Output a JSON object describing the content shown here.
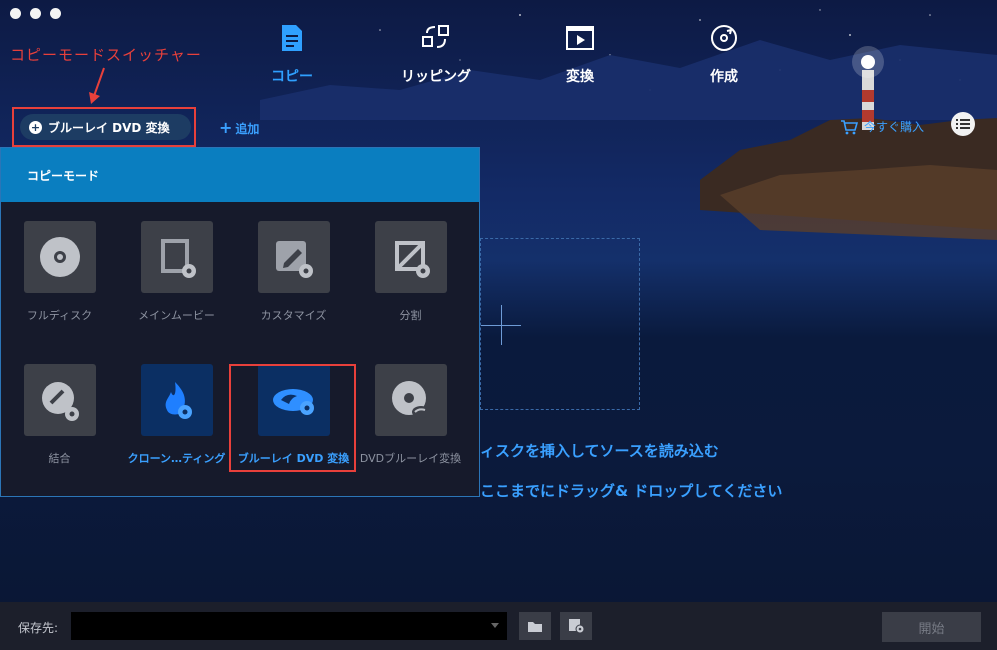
{
  "annotation": {
    "label": "コピーモードスイッチャー",
    "color": "#e8403b"
  },
  "nav": {
    "items": [
      {
        "label": "コピー",
        "icon": "copy-document-icon",
        "active": true
      },
      {
        "label": "リッピング",
        "icon": "ripping-arrows-icon",
        "active": false
      },
      {
        "label": "変換",
        "icon": "video-play-icon",
        "active": false
      },
      {
        "label": "作成",
        "icon": "disc-burn-icon",
        "active": false
      }
    ]
  },
  "toolbar": {
    "mode_button_label": "ブルーレイ DVD 変換",
    "add_label": "追加",
    "buy_label": "今すぐ購入"
  },
  "panel": {
    "title": "コピーモード",
    "tiles": [
      {
        "label": "フルディスク",
        "icon": "full-disc-icon"
      },
      {
        "label": "メインムービー",
        "icon": "main-movie-icon"
      },
      {
        "label": "カスタマイズ",
        "icon": "customize-icon"
      },
      {
        "label": "分割",
        "icon": "split-icon"
      },
      {
        "label": "結合",
        "icon": "merge-icon"
      },
      {
        "label": "クローン…ティング",
        "icon": "clone-fire-icon"
      },
      {
        "label": "ブルーレイ DVD 変換",
        "icon": "bluray-dvd-icon"
      },
      {
        "label": "DVDブルーレイ変換",
        "icon": "dvd-bluray-icon"
      }
    ]
  },
  "dropzone": {
    "line1": "ィスクを挿入してソースを読み込む",
    "line2": "ここまでにドラッグ& ドロップしてください"
  },
  "bottom": {
    "save_to_label": "保存先:",
    "path_value": "",
    "start_label": "開始"
  },
  "colors": {
    "accent": "#3aa0ff",
    "panel_header": "#0a7ec0",
    "highlight_box": "#e8403b"
  }
}
